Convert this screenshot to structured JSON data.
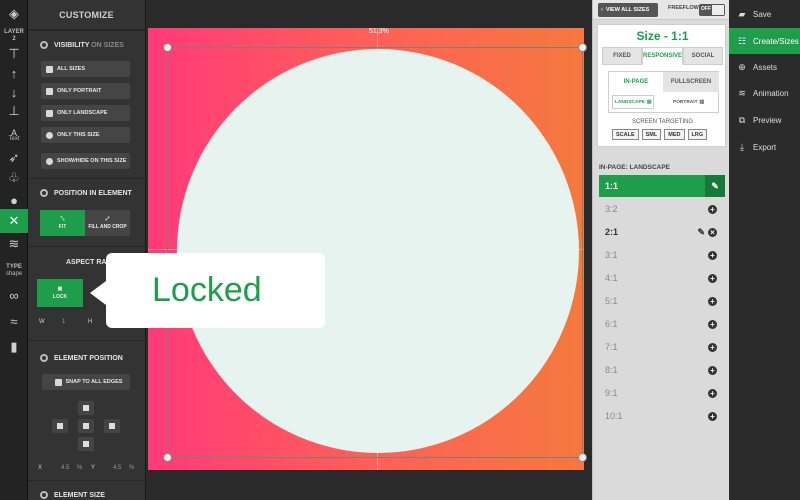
{
  "rail": {
    "layer_label": "LAYER",
    "layer_number": "2",
    "text_label": "Text",
    "type_label": "TYPE",
    "type_value": "shape"
  },
  "panel": {
    "header": "CUSTOMIZE",
    "visibility": {
      "title": "VISIBILITY",
      "title_suffix": "ON SIZES",
      "buttons": [
        "ALL SIZES",
        "ONLY PORTRAIT",
        "ONLY LANDSCAPE",
        "ONLY THIS SIZE",
        "SHOW/HIDE ON THIS SIZE"
      ]
    },
    "position": {
      "title": "POSITION IN ELEMENT",
      "fit": "FIT",
      "fill": "FILL AND CROP"
    },
    "aspect": {
      "title": "ASPECT RATIO",
      "lock": "LOCK",
      "w_label": "W",
      "w_value": "1",
      "h_label": "H"
    },
    "element_position": {
      "title": "ELEMENT POSITION",
      "snap": "SNAP TO ALL EDGES",
      "x_label": "X",
      "x_value": "4.5",
      "x_unit": "%",
      "y_label": "Y",
      "y_value": "4.5",
      "y_unit": "%"
    },
    "element_size": {
      "title": "ELEMENT SIZE"
    }
  },
  "canvas": {
    "zoom_label": "51.3%",
    "callout": "Locked"
  },
  "sizes": {
    "view_all": "VIEW ALL SIZES",
    "freeflow": "FREEFLOW",
    "toggle": "OFF",
    "title": "Size - 1:1",
    "tabs": [
      "FIXED",
      "RESPONSIVE",
      "SOCIAL"
    ],
    "subtabs": [
      "IN-PAGE",
      "FULLSCREEN"
    ],
    "orient": [
      "LANDSCAPE",
      "PORTRAIT"
    ],
    "targeting": "SCREEN TARGETING",
    "target_buttons": [
      "SCALE",
      "SML",
      "MED",
      "LRG"
    ],
    "list_heading": "IN-PAGE: LANDSCAPE",
    "list": [
      "1:1",
      "3:2",
      "2:1",
      "3:1",
      "4:1",
      "5:1",
      "6:1",
      "7:1",
      "8:1",
      "9:1",
      "10:1"
    ]
  },
  "menu": {
    "items": [
      "Save",
      "Create/Sizes",
      "Assets",
      "Animation",
      "Preview",
      "Export"
    ]
  },
  "colors": {
    "accent": "#1e9d4a",
    "gradient_start": "#ff3a7a",
    "gradient_end": "#f4793e",
    "shape_fill": "#e6f3ee"
  }
}
